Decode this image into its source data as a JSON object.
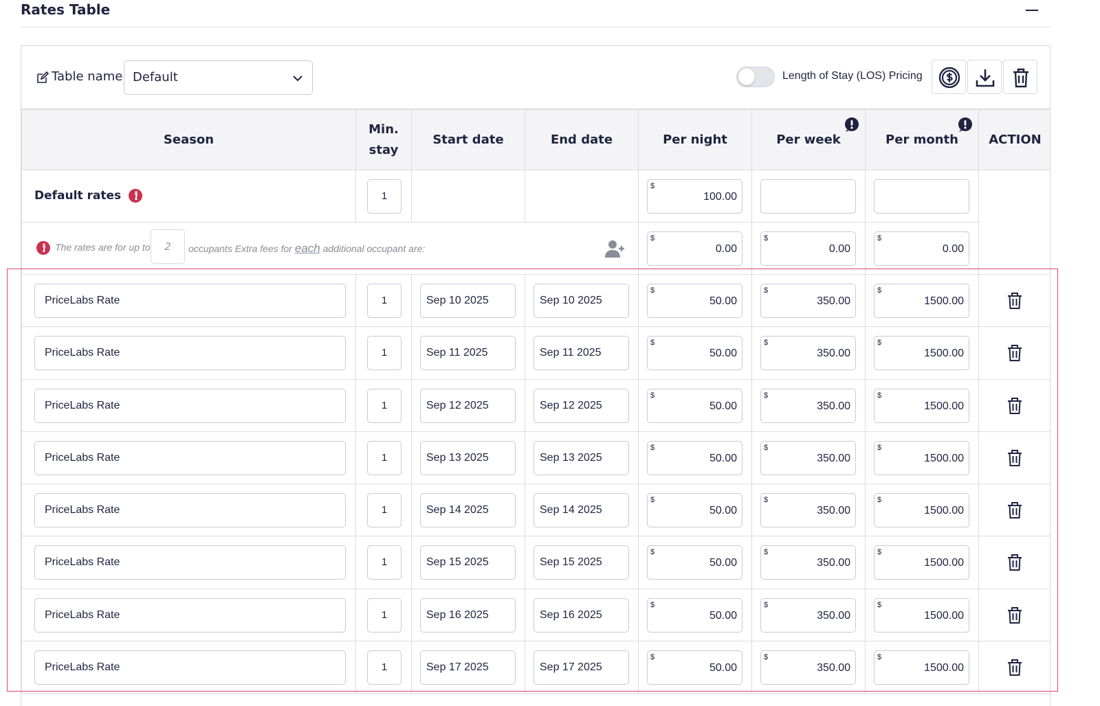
{
  "section": {
    "title": "Rates Table"
  },
  "toolbar": {
    "table_name_label": "Table name:",
    "table_name_value": "Default",
    "los_label": "Length of Stay (LOS) Pricing",
    "los_enabled": false
  },
  "columns": {
    "season": "Season",
    "min_stay": "Min. stay",
    "start_date": "Start date",
    "end_date": "End date",
    "per_night": "Per night",
    "per_week": "Per week",
    "per_month": "Per month",
    "action": "ACTION"
  },
  "default_rates": {
    "label": "Default rates",
    "min_stay": "1",
    "currency": "$",
    "per_night": "100.00",
    "per_week": "",
    "per_month": ""
  },
  "occupants": {
    "text_before": "The rates are for up to",
    "count": "2",
    "text_middle": "occupants Extra fees for",
    "text_emph": "each",
    "text_after": "additional occupant are:",
    "currency": "$",
    "per_night": "0.00",
    "per_week": "0.00",
    "per_month": "0.00"
  },
  "rows": [
    {
      "season": "PriceLabs Rate",
      "min_stay": "1",
      "start": "Sep 10 2025",
      "end": "Sep 10 2025",
      "night": "50.00",
      "week": "350.00",
      "month": "1500.00"
    },
    {
      "season": "PriceLabs Rate",
      "min_stay": "1",
      "start": "Sep 11 2025",
      "end": "Sep 11 2025",
      "night": "50.00",
      "week": "350.00",
      "month": "1500.00"
    },
    {
      "season": "PriceLabs Rate",
      "min_stay": "1",
      "start": "Sep 12 2025",
      "end": "Sep 12 2025",
      "night": "50.00",
      "week": "350.00",
      "month": "1500.00"
    },
    {
      "season": "PriceLabs Rate",
      "min_stay": "1",
      "start": "Sep 13 2025",
      "end": "Sep 13 2025",
      "night": "50.00",
      "week": "350.00",
      "month": "1500.00"
    },
    {
      "season": "PriceLabs Rate",
      "min_stay": "1",
      "start": "Sep 14 2025",
      "end": "Sep 14 2025",
      "night": "50.00",
      "week": "350.00",
      "month": "1500.00"
    },
    {
      "season": "PriceLabs Rate",
      "min_stay": "1",
      "start": "Sep 15 2025",
      "end": "Sep 15 2025",
      "night": "50.00",
      "week": "350.00",
      "month": "1500.00"
    },
    {
      "season": "PriceLabs Rate",
      "min_stay": "1",
      "start": "Sep 16 2025",
      "end": "Sep 16 2025",
      "night": "50.00",
      "week": "350.00",
      "month": "1500.00"
    },
    {
      "season": "PriceLabs Rate",
      "min_stay": "1",
      "start": "Sep 17 2025",
      "end": "Sep 17 2025",
      "night": "50.00",
      "week": "350.00",
      "month": "1500.00"
    }
  ],
  "colors": {
    "text": "#1f2340",
    "accent_red": "#c8324f",
    "highlight_border": "#e0446a",
    "header_bg": "#f4f4f6"
  },
  "icons": [
    "edit-icon",
    "chevron-down-icon",
    "dollar-circle-icon",
    "download-icon",
    "trash-icon",
    "info-icon",
    "warning-icon",
    "add-user-icon"
  ]
}
